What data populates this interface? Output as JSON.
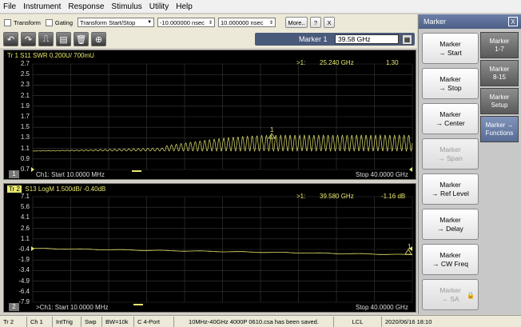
{
  "menu": [
    "File",
    "Instrument",
    "Response",
    "Stimulus",
    "Utility",
    "Help"
  ],
  "toolbar1": {
    "transform_label": "Transform",
    "gating_label": "Gating",
    "transform_combo": "Transform Start/Stop",
    "time1": "-10.000000 nsec",
    "time2": "10.000000 nsec",
    "more_label": "More..",
    "help_label": "?",
    "close_label": "X"
  },
  "toolbar2": {
    "icons": [
      "undo-icon",
      "redo-icon",
      "pulse-icon",
      "display-icon",
      "trash-icon",
      "zoom-icon"
    ],
    "marker_label": "Marker 1",
    "marker_value": "39.58 GHz"
  },
  "trace1": {
    "header": "Tr 1   S11 SWR 0.200U/ 700mU",
    "marker_readout": ">1:",
    "marker_freq": "25.240  GHz",
    "marker_value": "1.30",
    "marker_tag": "1",
    "number": "1",
    "start": "Ch1:  Start  10.0000 MHz",
    "stop": "Stop  40.0000 GHz",
    "yticks": [
      "2.7",
      "2.5",
      "2.3",
      "2.1",
      "1.9",
      "1.7",
      "1.5",
      "1.3",
      "1.1",
      "0.9",
      "0.7"
    ]
  },
  "trace2": {
    "header_tag": "Tr 2",
    "header": "S13 LogM 1.500dB/ -0.40dB",
    "marker_readout": ">1:",
    "marker_freq": "39.580  GHz",
    "marker_value": "-1.16 dB",
    "marker_tag": "1",
    "number": "2",
    "start": ">Ch1:  Start  10.0000 MHz",
    "stop": "Stop  40.0000 GHz",
    "yticks": [
      "7.1",
      "5.6",
      "4.1",
      "2.6",
      "1.1",
      "-0.4",
      "-1.9",
      "-3.4",
      "-4.9",
      "-6.4",
      "-7.9"
    ]
  },
  "panel": {
    "title": "Marker",
    "close": "X",
    "softkeys": [
      {
        "l1": "Marker",
        "l2": "→ Start",
        "enabled": true
      },
      {
        "l1": "Marker",
        "l2": "→ Stop",
        "enabled": true
      },
      {
        "l1": "Marker",
        "l2": "→ Center",
        "enabled": true
      },
      {
        "l1": "Marker",
        "l2": "→ Span",
        "enabled": false
      },
      {
        "l1": "Marker",
        "l2": "→ Ref Level",
        "enabled": true
      },
      {
        "l1": "Marker",
        "l2": "→ Delay",
        "enabled": true
      },
      {
        "l1": "Marker",
        "l2": "→ CW Freq",
        "enabled": true
      },
      {
        "l1": "Marker",
        "l2": "→ SA",
        "enabled": false
      }
    ],
    "tabs": [
      {
        "l1": "Marker",
        "l2": "1-7"
      },
      {
        "l1": "Marker",
        "l2": "8-15"
      },
      {
        "l1": "Marker",
        "l2": "Setup"
      },
      {
        "l1": "Marker →",
        "l2": "Functions"
      }
    ]
  },
  "status": [
    "Tr 2",
    "Ch 1",
    "IntTrig",
    "Swp",
    "BW=10k",
    "C  4-Port",
    "10MHz-40GHz 4000P 0610.csa has been saved.",
    "LCL",
    "2020/06/16 18:10"
  ],
  "colors": {
    "trace": "#e8e870",
    "grid": "#3a3a3a",
    "panel_header": "#586c95"
  }
}
